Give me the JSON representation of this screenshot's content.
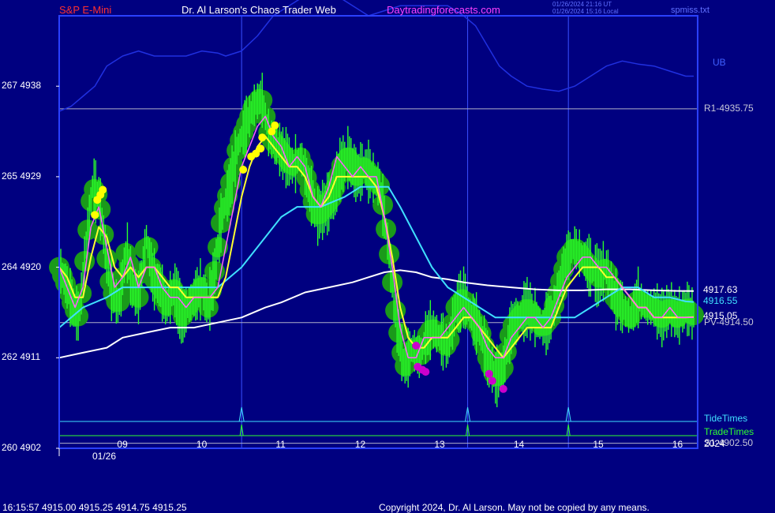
{
  "header": {
    "symbol": "S&P E-Mini",
    "site": "Dr. Al Larson's Chaos Trader Web",
    "url": "Daytradingforecasts.com",
    "timestamp_ut": "01/26/2024 21:16 UT",
    "timestamp_local": "01/26/2024 15:16 Local",
    "file": "spmiss.txt"
  },
  "footer": {
    "ohlc": "16:15:57  4915.00 4915.25 4914.75 4915.25",
    "copyright": "Copyright 2024, Dr. Al Larson. May not be copied by any means."
  },
  "colors": {
    "background": "#000080",
    "price": "#2aff2a",
    "halo": "#1a9a1a",
    "fast_avg": "#ff60ff",
    "mid_avg": "#ffff30",
    "slow_avg": "#40e0ff",
    "long_avg": "#ffffff",
    "band": "#2030e0",
    "dots_top": "#ffff00",
    "dots_bottom": "#cc00cc",
    "frame": "#2a40ff"
  },
  "chart_data": {
    "type": "line",
    "title": "S&P E-Mini",
    "date_label": "01/26",
    "year_label": "2024",
    "ylim": [
      4902,
      4945
    ],
    "xlim": [
      8.2,
      16.25
    ],
    "y_ticks": [
      {
        "value": 4902,
        "label": "260  4902"
      },
      {
        "value": 4911,
        "label": "262  4911"
      },
      {
        "value": 4920,
        "label": "264  4920"
      },
      {
        "value": 4929,
        "label": "265  4929"
      },
      {
        "value": 4938,
        "label": "267  4938"
      }
    ],
    "x_ticks": [
      "09",
      "10",
      "11",
      "12",
      "13",
      "14",
      "15",
      "16"
    ],
    "x_tick_values": [
      9,
      10,
      11,
      12,
      13,
      14,
      15,
      16
    ],
    "levels": [
      {
        "label": "R1-4935.75",
        "value": 4935.75
      },
      {
        "label": "PV-4914.50",
        "value": 4914.5
      },
      {
        "label": "S1-4902.50",
        "value": 4902.5
      }
    ],
    "end_values": [
      {
        "label": "4917.63",
        "value": 4917.63,
        "series": "long_avg"
      },
      {
        "label": "4916.55",
        "value": 4916.55,
        "series": "slow_avg"
      },
      {
        "label": "4915.05",
        "value": 4915.05,
        "series": "mid_avg"
      }
    ],
    "upper_band_label": "UB",
    "tide_label": "TideTimes",
    "trade_label": "TradeTimes",
    "spike_times": [
      10.5,
      13.35,
      14.62
    ],
    "series": [
      {
        "key": "price",
        "x": [
          8.2,
          8.3,
          8.38,
          8.45,
          8.55,
          8.62,
          8.7,
          8.78,
          8.85,
          8.95,
          9.05,
          9.12,
          9.2,
          9.3,
          9.38,
          9.48,
          9.55,
          9.65,
          9.75,
          9.82,
          9.9,
          10.0,
          10.08,
          10.15,
          10.25,
          10.35,
          10.45,
          10.55,
          10.65,
          10.75,
          10.85,
          10.95,
          11.05,
          11.15,
          11.25,
          11.35,
          11.45,
          11.55,
          11.65,
          11.75,
          11.85,
          11.95,
          12.05,
          12.15,
          12.25,
          12.35,
          12.45,
          12.55,
          12.65,
          12.75,
          12.82,
          12.9,
          13.0,
          13.1,
          13.2,
          13.3,
          13.4,
          13.5,
          13.6,
          13.7,
          13.8,
          13.9,
          14.0,
          14.1,
          14.2,
          14.3,
          14.4,
          14.5,
          14.6,
          14.7,
          14.8,
          14.9,
          15.0,
          15.1,
          15.2,
          15.3,
          15.4,
          15.5,
          15.6,
          15.7,
          15.8,
          15.9,
          16.0,
          16.1,
          16.2
        ],
        "values": [
          4920,
          4918,
          4916,
          4915,
          4923,
          4928,
          4927,
          4922,
          4918,
          4916,
          4922,
          4918,
          4917,
          4923,
          4919,
          4918,
          4916,
          4918,
          4915,
          4916,
          4917,
          4918,
          4916,
          4919,
          4925,
          4928,
          4932,
          4934,
          4936,
          4937,
          4933,
          4932,
          4931,
          4930,
          4931,
          4928,
          4925,
          4926,
          4927,
          4930,
          4931,
          4929,
          4930,
          4929,
          4928,
          4922,
          4915,
          4910,
          4912,
          4911,
          4913,
          4914,
          4913,
          4912,
          4916,
          4917,
          4915,
          4914,
          4911,
          4909,
          4910,
          4914,
          4915,
          4916,
          4915,
          4914,
          4915,
          4918,
          4921,
          4922,
          4921,
          4920,
          4919,
          4920,
          4917,
          4916,
          4915,
          4917,
          4916,
          4916,
          4915,
          4916,
          4915,
          4916,
          4915.25
        ]
      },
      {
        "key": "fast_avg",
        "x": [
          8.2,
          8.3,
          8.4,
          8.5,
          8.6,
          8.7,
          8.8,
          8.9,
          9.0,
          9.1,
          9.2,
          9.3,
          9.4,
          9.5,
          9.6,
          9.7,
          9.8,
          9.9,
          10.0,
          10.1,
          10.2,
          10.3,
          10.4,
          10.5,
          10.6,
          10.7,
          10.8,
          10.9,
          11.0,
          11.1,
          11.2,
          11.3,
          11.4,
          11.5,
          11.6,
          11.7,
          11.8,
          11.9,
          12.0,
          12.1,
          12.2,
          12.3,
          12.4,
          12.5,
          12.6,
          12.7,
          12.8,
          12.9,
          13.0,
          13.1,
          13.2,
          13.3,
          13.4,
          13.5,
          13.6,
          13.7,
          13.8,
          13.9,
          14.0,
          14.1,
          14.2,
          14.3,
          14.4,
          14.5,
          14.6,
          14.7,
          14.8,
          14.9,
          15.0,
          15.1,
          15.2,
          15.3,
          15.4,
          15.5,
          15.6,
          15.7,
          15.8,
          15.9,
          16.0,
          16.1,
          16.2
        ],
        "values": [
          4920,
          4918,
          4916,
          4918,
          4924,
          4926,
          4922,
          4918,
          4919,
          4921,
          4918,
          4920,
          4920,
          4918,
          4917,
          4917,
          4916,
          4917,
          4917,
          4917,
          4918,
          4922,
          4926,
          4930,
          4932,
          4934,
          4935,
          4933,
          4932,
          4930,
          4931,
          4930,
          4927,
          4926,
          4928,
          4931,
          4930,
          4929,
          4930,
          4929,
          4929,
          4925,
          4920,
          4914,
          4911,
          4911,
          4913,
          4913,
          4913,
          4914,
          4915,
          4916,
          4915,
          4914,
          4912,
          4911,
          4911,
          4913,
          4914,
          4915,
          4915,
          4914,
          4915,
          4917,
          4919,
          4920,
          4921,
          4921,
          4920,
          4920,
          4919,
          4918,
          4917,
          4916,
          4916,
          4915,
          4915,
          4916,
          4915,
          4915,
          4915
        ]
      },
      {
        "key": "mid_avg",
        "x": [
          8.2,
          8.3,
          8.4,
          8.5,
          8.6,
          8.7,
          8.8,
          8.9,
          9.0,
          9.1,
          9.2,
          9.3,
          9.4,
          9.5,
          9.6,
          9.7,
          9.8,
          9.9,
          10.0,
          10.1,
          10.2,
          10.3,
          10.4,
          10.5,
          10.6,
          10.7,
          10.8,
          10.9,
          11.0,
          11.1,
          11.2,
          11.3,
          11.4,
          11.5,
          11.6,
          11.7,
          11.8,
          11.9,
          12.0,
          12.1,
          12.2,
          12.3,
          12.4,
          12.5,
          12.6,
          12.7,
          12.8,
          12.9,
          13.0,
          13.1,
          13.2,
          13.3,
          13.4,
          13.5,
          13.6,
          13.7,
          13.8,
          13.9,
          14.0,
          14.1,
          14.2,
          14.3,
          14.4,
          14.5,
          14.6,
          14.7,
          14.8,
          14.9,
          15.0,
          15.1,
          15.2,
          15.3,
          15.4,
          15.5,
          15.6,
          15.7,
          15.8,
          15.9,
          16.0,
          16.1,
          16.2
        ],
        "values": [
          4920,
          4919,
          4917,
          4917,
          4921,
          4924,
          4923,
          4920,
          4919,
          4920,
          4919,
          4920,
          4920,
          4919,
          4918,
          4918,
          4917,
          4917,
          4917,
          4917,
          4917,
          4919,
          4923,
          4927,
          4930,
          4932,
          4933,
          4932,
          4931,
          4930,
          4930,
          4929,
          4927,
          4926,
          4927,
          4929,
          4929,
          4929,
          4929,
          4929,
          4928,
          4925,
          4921,
          4916,
          4913,
          4912,
          4912,
          4913,
          4913,
          4913,
          4914,
          4915,
          4915,
          4914,
          4913,
          4912,
          4911,
          4912,
          4913,
          4914,
          4914,
          4914,
          4914,
          4916,
          4918,
          4919,
          4920,
          4920,
          4920,
          4919,
          4919,
          4918,
          4917,
          4916,
          4916,
          4915,
          4915,
          4915,
          4915,
          4915,
          4915.05
        ]
      },
      {
        "key": "slow_avg",
        "x": [
          8.2,
          8.5,
          8.8,
          9.0,
          9.3,
          9.6,
          9.9,
          10.2,
          10.5,
          10.8,
          11.0,
          11.2,
          11.5,
          11.8,
          12.0,
          12.2,
          12.35,
          12.5,
          12.7,
          12.9,
          13.1,
          13.3,
          13.5,
          13.7,
          13.9,
          14.1,
          14.3,
          14.5,
          14.7,
          14.9,
          15.1,
          15.3,
          15.5,
          15.7,
          15.9,
          16.1,
          16.2
        ],
        "values": [
          4914,
          4916,
          4917,
          4918,
          4918,
          4918,
          4918,
          4918,
          4920,
          4923,
          4925,
          4926,
          4926,
          4927,
          4928,
          4928,
          4928,
          4926,
          4923,
          4920,
          4918,
          4917,
          4916,
          4915,
          4915,
          4915,
          4915,
          4915,
          4915,
          4916,
          4917,
          4918,
          4918,
          4917,
          4917,
          4916.6,
          4916.55
        ]
      },
      {
        "key": "long_avg",
        "x": [
          8.2,
          8.5,
          8.8,
          9.0,
          9.3,
          9.6,
          9.9,
          10.2,
          10.5,
          10.8,
          11.0,
          11.3,
          11.6,
          11.9,
          12.1,
          12.3,
          12.5,
          12.7,
          12.9,
          13.1,
          13.3,
          13.6,
          13.9,
          14.2,
          14.5,
          14.8,
          15.1,
          15.4,
          15.7,
          16.0,
          16.2
        ],
        "values": [
          4911,
          4911.5,
          4912,
          4913,
          4913.5,
          4914,
          4914,
          4914.5,
          4915,
          4916,
          4916.5,
          4917.5,
          4918,
          4918.5,
          4919,
          4919.5,
          4919.7,
          4919.5,
          4919,
          4918.8,
          4918.5,
          4918.2,
          4918,
          4917.8,
          4917.7,
          4917.7,
          4917.8,
          4917.8,
          4917.7,
          4917.65,
          4917.63
        ]
      },
      {
        "key": "band",
        "x": [
          8.2,
          8.35,
          8.5,
          8.65,
          8.8,
          9.0,
          9.2,
          9.4,
          9.6,
          9.8,
          10.0,
          10.2,
          10.3,
          10.5,
          10.7,
          10.9,
          11.1,
          11.3,
          11.5,
          11.7,
          11.9,
          12.1,
          12.3,
          12.5,
          12.7,
          12.9,
          13.1,
          13.3,
          13.45,
          13.6,
          13.75,
          13.9,
          14.1,
          14.3,
          14.5,
          14.7,
          14.9,
          15.1,
          15.3,
          15.5,
          15.7,
          15.9,
          16.1,
          16.2
        ],
        "values": [
          4935.5,
          4936,
          4937,
          4938,
          4940,
          4941,
          4941.5,
          4941,
          4941,
          4941,
          4941.5,
          4941.3,
          4941,
          4941.5,
          4943,
          4945,
          4946,
          4947,
          4947.5,
          4947,
          4946,
          4945,
          4945.5,
          4946,
          4946,
          4946,
          4946,
          4945,
          4944,
          4942,
          4940,
          4939,
          4938,
          4937.7,
          4937.5,
          4938,
          4939,
          4940,
          4940.5,
          4940.2,
          4940,
          4939.5,
          4939,
          4939
        ]
      }
    ],
    "dots_top": [
      {
        "x": 8.68,
        "y": 4926.7
      },
      {
        "x": 8.72,
        "y": 4927.2
      },
      {
        "x": 8.75,
        "y": 4927.7
      },
      {
        "x": 8.65,
        "y": 4925.2
      },
      {
        "x": 10.52,
        "y": 4929.7
      },
      {
        "x": 10.62,
        "y": 4931.0
      },
      {
        "x": 10.68,
        "y": 4931.3
      },
      {
        "x": 10.74,
        "y": 4931.8
      },
      {
        "x": 10.76,
        "y": 4932.9
      },
      {
        "x": 10.88,
        "y": 4933.5
      },
      {
        "x": 10.92,
        "y": 4934.1
      }
    ],
    "dots_bottom": [
      {
        "x": 12.7,
        "y": 4912.2
      },
      {
        "x": 12.72,
        "y": 4910.1
      },
      {
        "x": 12.78,
        "y": 4909.8
      },
      {
        "x": 12.82,
        "y": 4909.6
      },
      {
        "x": 13.62,
        "y": 4909.4
      },
      {
        "x": 13.66,
        "y": 4908.7
      },
      {
        "x": 13.8,
        "y": 4907.9
      }
    ]
  }
}
